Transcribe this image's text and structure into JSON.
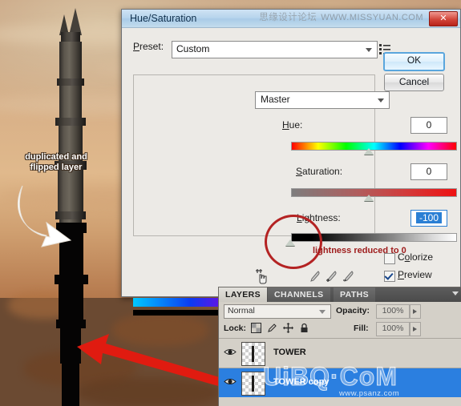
{
  "watermarks": {
    "top_cn": "思缘设计论坛",
    "top_url": "WWW.MISSYUAN.COM",
    "layers_brand": "UiBQ·CoM",
    "layers_url": "www.psanz.com"
  },
  "annotations": {
    "white_note": "duplicated and\nflipped layer",
    "white_note_line1": "duplicated and",
    "white_note_line2": "flipped layer",
    "red_note": "lightness reduced to 0"
  },
  "dialog": {
    "title": "Hue/Saturation",
    "close_label": "✕",
    "preset_label": "Preset:",
    "preset_value": "Custom",
    "preset_menu_icon": "preset-menu-icon",
    "ok_label": "OK",
    "cancel_label": "Cancel",
    "channel_value": "Master",
    "sliders": [
      {
        "label": "Hue:",
        "value": "0",
        "selected": false
      },
      {
        "label": "Saturation:",
        "value": "0",
        "selected": false
      },
      {
        "label": "Lightness:",
        "value": "-100",
        "selected": true
      }
    ],
    "hand_icon": "target-adjust-hand-icon",
    "eyedroppers": [
      "eyedropper-icon",
      "eyedropper-plus-icon",
      "eyedropper-minus-icon"
    ],
    "colorize": {
      "label": "Colorize",
      "checked": false
    },
    "preview": {
      "label": "Preview",
      "checked": true
    }
  },
  "layers_panel": {
    "tabs": [
      {
        "label": "LAYERS",
        "active": true
      },
      {
        "label": "CHANNELS",
        "active": false
      },
      {
        "label": "PATHS",
        "active": false
      }
    ],
    "blend_mode": "Normal",
    "opacity_label": "Opacity:",
    "opacity_value": "100%",
    "lock_label": "Lock:",
    "lock_icons": [
      "lock-transparency-icon",
      "lock-image-icon",
      "lock-position-icon",
      "lock-all-icon"
    ],
    "fill_label": "Fill:",
    "fill_value": "100%",
    "layers": [
      {
        "name": "TOWER",
        "selected": false,
        "visible": true
      },
      {
        "name": "TOWER copy",
        "selected": true,
        "visible": true
      }
    ]
  },
  "colors": {
    "accent_blue": "#2b7fe0",
    "selection_blue": "#2a7fd4",
    "annotation_red": "#9e1b1b",
    "arrow_red": "#e01b10",
    "title_blue": "#b6d4ec",
    "panel_gray": "#d4d0c8"
  }
}
